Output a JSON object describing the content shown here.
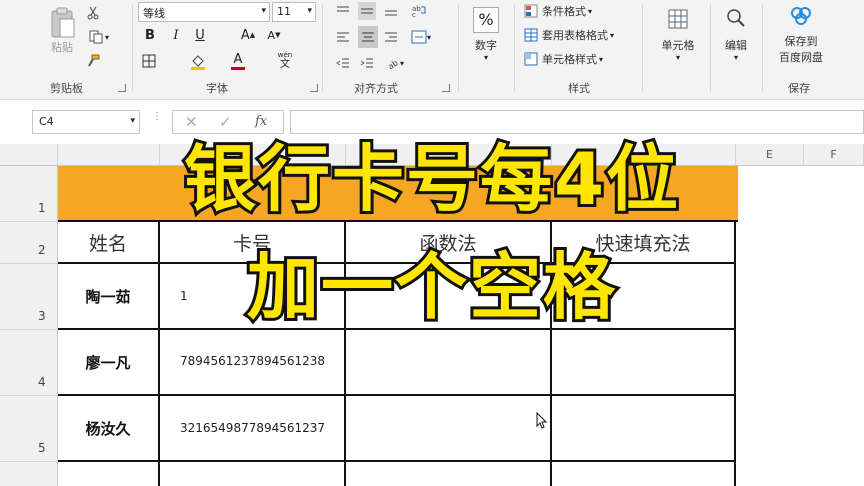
{
  "ribbon": {
    "clipboard": {
      "paste_label": "粘贴",
      "group_label": "剪贴板"
    },
    "font": {
      "font_name": "等线",
      "font_size": "11",
      "bold": "B",
      "italic": "I",
      "underline": "U",
      "font_color_letter": "A",
      "wen_top": "wén",
      "wen_bottom": "文",
      "group_label": "字体"
    },
    "alignment": {
      "group_label": "对齐方式"
    },
    "number": {
      "percent": "%",
      "label": "数字"
    },
    "styles": {
      "conditional_format": "条件格式",
      "table_format": "套用表格格式",
      "cell_styles": "单元格样式",
      "group_label": "样式"
    },
    "cells": {
      "label": "单元格"
    },
    "editing": {
      "label": "编辑"
    },
    "save": {
      "label_line1": "保存到",
      "label_line2": "百度网盘",
      "group_label": "保存"
    }
  },
  "formula_bar": {
    "name_box": "C4",
    "fx": "fx"
  },
  "grid": {
    "col_headers": [
      "E",
      "F"
    ],
    "row_numbers": [
      "1",
      "2",
      "3",
      "4",
      "5"
    ],
    "header_row": [
      "姓名",
      "卡号",
      "函数法",
      "快速填充法"
    ],
    "rows": [
      {
        "name": "陶一茹",
        "card": "1"
      },
      {
        "name": "廖一凡",
        "card": "7894561237894561238"
      },
      {
        "name": "杨汝久",
        "card": "3216549877894561237"
      }
    ]
  },
  "overlay": {
    "line1": "银行卡号每4位",
    "line2": "加一个空格"
  },
  "colors": {
    "title_band": "#f5a623",
    "caption_fill": "#ffe600",
    "caption_stroke": "#111111"
  }
}
